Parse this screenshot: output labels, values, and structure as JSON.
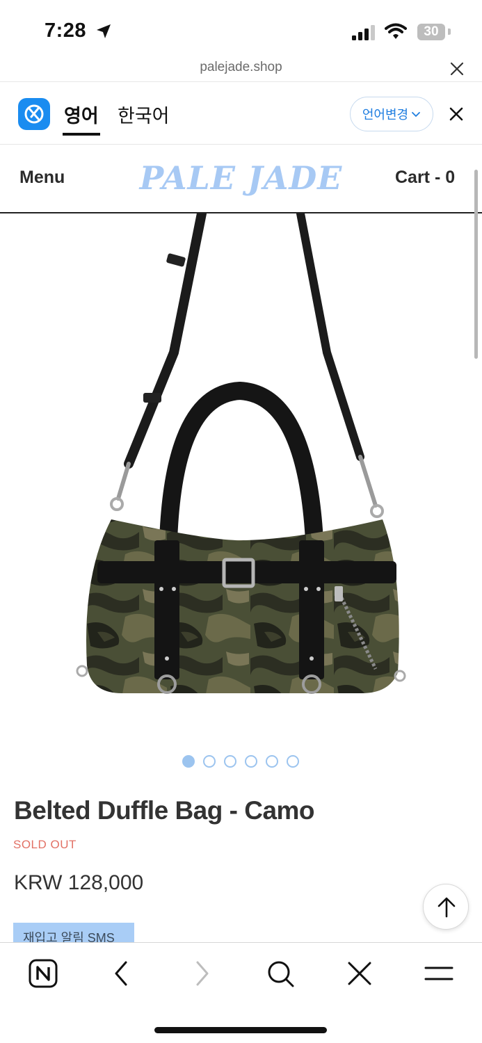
{
  "status_bar": {
    "time": "7:28",
    "battery": "30"
  },
  "browser": {
    "url": "palejade.shop"
  },
  "translate_bar": {
    "tab_english": "영어",
    "tab_korean": "한국어",
    "change_language_label": "언어변경"
  },
  "site_header": {
    "menu_label": "Menu",
    "logo_text": "PALE JADE",
    "cart_label": "Cart - 0"
  },
  "product": {
    "image_alt": "Belted Duffle Bag - Camo",
    "carousel_dot_count": 6,
    "carousel_active_index": 0,
    "title": "Belted Duffle Bag - Camo",
    "stock_status": "SOLD OUT",
    "price": "KRW 128,000",
    "restock_alert_label": "재입고 알림 SMS"
  },
  "colors": {
    "logo": "#a7c9f4",
    "sold_out": "#e27165",
    "accent_blue": "#1f7ee0",
    "badge": "#a9cdf6"
  },
  "toolbar": {
    "icons": [
      "naver-n-icon",
      "back-icon",
      "forward-icon",
      "search-icon",
      "close-icon",
      "menu-icon"
    ]
  }
}
